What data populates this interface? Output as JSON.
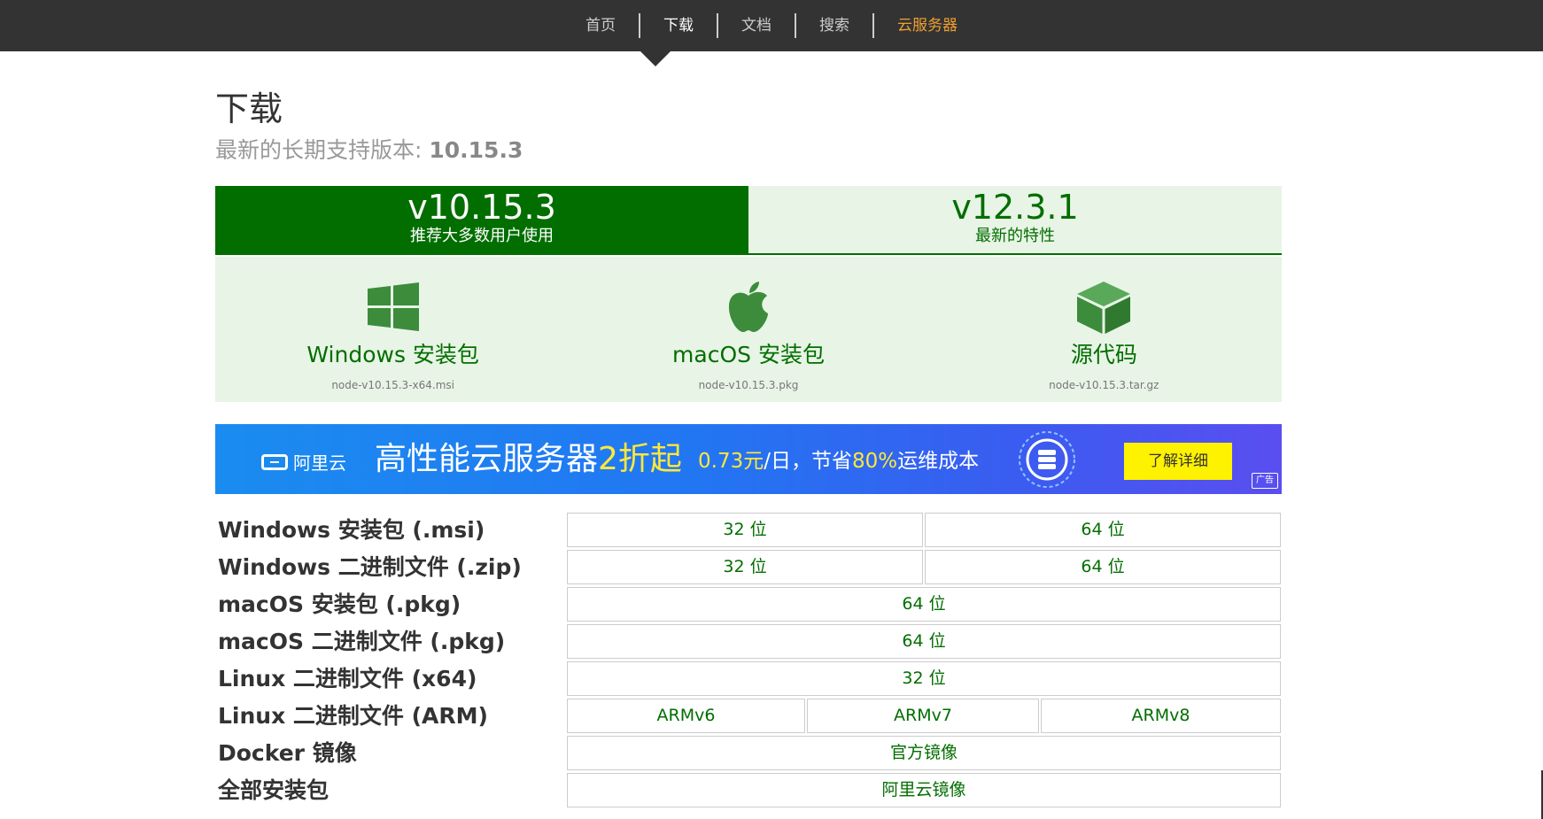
{
  "nav": {
    "items": [
      {
        "label": "首页"
      },
      {
        "label": "下载"
      },
      {
        "label": "文档"
      },
      {
        "label": "搜索"
      },
      {
        "label": "云服务器"
      }
    ]
  },
  "page": {
    "title": "下载",
    "lts_label": "最新的长期支持版本: ",
    "lts_version": "10.15.3"
  },
  "versions": [
    {
      "number": "v10.15.3",
      "desc": "推荐大多数用户使用"
    },
    {
      "number": "v12.3.1",
      "desc": "最新的特性"
    }
  ],
  "downloads": [
    {
      "icon": "windows-logo-icon",
      "label": "Windows 安装包",
      "file": "node-v10.15.3-x64.msi"
    },
    {
      "icon": "apple-logo-icon",
      "label": "macOS 安装包",
      "file": "node-v10.15.3.pkg"
    },
    {
      "icon": "source-box-icon",
      "label": "源代码",
      "file": "node-v10.15.3.tar.gz"
    }
  ],
  "ad": {
    "brand": "阿里云",
    "headline_pre": "高性能云服务器",
    "headline_accent": "2折起",
    "sub_a": "0.73元",
    "sub_b": "/日，节省",
    "sub_c": "80%",
    "sub_d": "运维成本",
    "cta": "了解详细",
    "tag": "广告",
    "colors": {
      "accent": "#ffe83a",
      "cta_bg": "#fff200"
    }
  },
  "table": {
    "rows": [
      {
        "label": "Windows 安装包 (.msi)",
        "cells": [
          "32 位",
          "64 位"
        ]
      },
      {
        "label": "Windows 二进制文件 (.zip)",
        "cells": [
          "32 位",
          "64 位"
        ]
      },
      {
        "label": "macOS 安装包 (.pkg)",
        "cells": [
          "64 位"
        ]
      },
      {
        "label": "macOS 二进制文件 (.pkg)",
        "cells": [
          "64 位"
        ]
      },
      {
        "label": "Linux 二进制文件 (x64)",
        "cells": [
          "32 位"
        ]
      },
      {
        "label": "Linux 二进制文件 (ARM)",
        "cells": [
          "ARMv6",
          "ARMv7",
          "ARMv8"
        ]
      },
      {
        "label": "Docker 镜像",
        "cells": [
          "官方镜像"
        ]
      },
      {
        "label": "全部安装包",
        "cells": [
          "阿里云镜像"
        ]
      }
    ]
  },
  "colors": {
    "brand_green": "#026e00",
    "light_green": "#e8f4e6",
    "nav_bg": "#333333",
    "nav_highlight": "#f0a030"
  }
}
